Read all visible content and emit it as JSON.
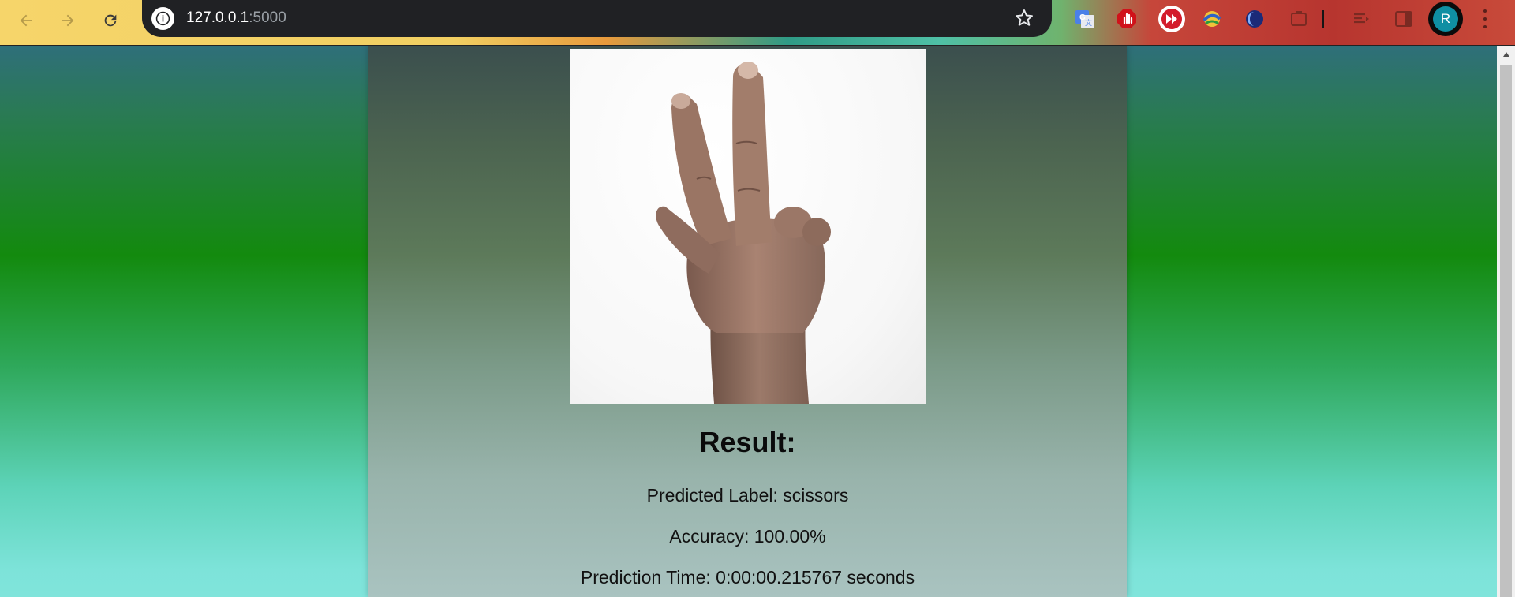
{
  "browser": {
    "url_host": "127.0.0.1",
    "url_port": ":5000",
    "profile_initial": "R"
  },
  "result": {
    "heading": "Result:",
    "predicted_label": "Predicted Label: scissors",
    "accuracy": "Accuracy: 100.00%",
    "prediction_time": "Prediction Time: 0:00:00.215767 seconds"
  }
}
